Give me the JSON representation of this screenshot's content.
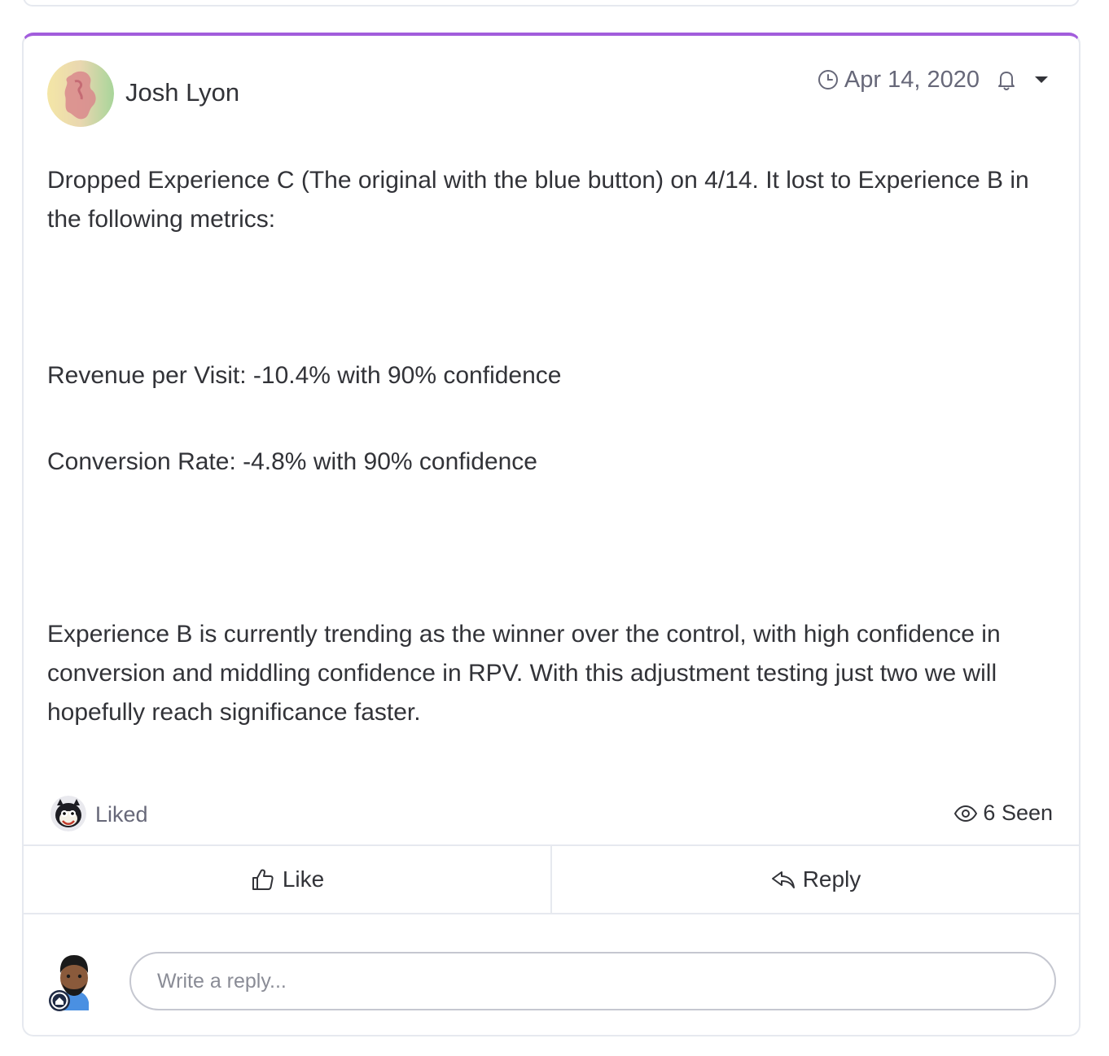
{
  "update": {
    "author": "Josh Lyon",
    "date": "Apr 14, 2020",
    "accent_color": "#a25ddc",
    "paragraphs": {
      "intro": "Dropped Experience C (The original with the blue button) on 4/14. It lost to Experience B in the following metrics:",
      "metric_rpv": "Revenue per Visit: -10.4% with 90% confidence",
      "metric_conversion": "Conversion Rate: -4.8% with 90% confidence",
      "conclusion": "Experience B is currently trending as the winner over the control, with high confidence in conversion and middling confidence in RPV. With this adjustment testing just two we will hopefully reach significance faster."
    }
  },
  "stats": {
    "liked_label": "Liked",
    "seen_label": "6 Seen"
  },
  "actions": {
    "like_label": "Like",
    "reply_label": "Reply"
  },
  "reply": {
    "placeholder": "Write a reply..."
  },
  "icons": {
    "clock": "clock-icon",
    "bell": "bell-icon",
    "caret": "caret-down-icon",
    "eye": "eye-icon",
    "like": "thumbs-up-icon",
    "reply": "reply-arrow-icon"
  }
}
